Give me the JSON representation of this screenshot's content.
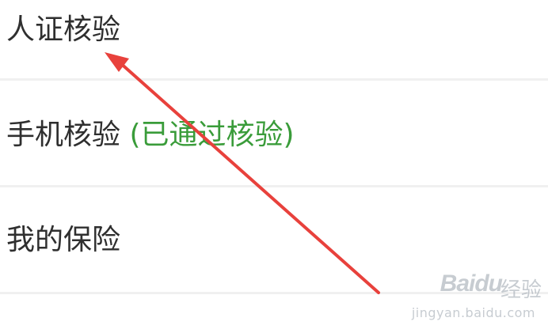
{
  "menu": {
    "items": [
      {
        "label": "人证核验",
        "status": ""
      },
      {
        "label": "手机核验",
        "status": "(已通过核验)"
      },
      {
        "label": "我的保险",
        "status": ""
      }
    ]
  },
  "annotation": {
    "arrow_color": "#e8413c",
    "arrow_icon": "red-arrow-pointing-up-left"
  },
  "watermark": {
    "logo": "Bai",
    "logo_tail": "du",
    "label": "经验",
    "url": "jingyan.baidu.com"
  },
  "colors": {
    "status_green": "#3a9c3a",
    "text": "#2f2f2f",
    "divider": "#f0f0f0"
  }
}
